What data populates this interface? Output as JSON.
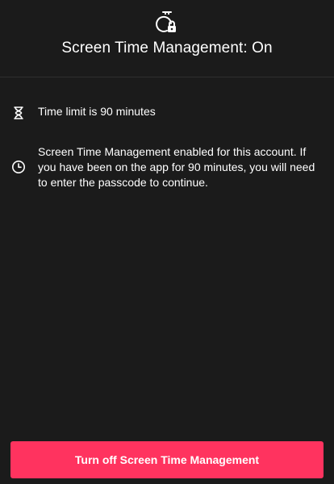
{
  "header": {
    "title": "Screen Time Management: On",
    "icon": "stopwatch-lock-icon"
  },
  "info": {
    "limit": {
      "icon": "hourglass-icon",
      "text": "Time limit is 90 minutes"
    },
    "description": {
      "icon": "clock-icon",
      "text": "Screen Time Management enabled for this account. If you have been on the app for 90 minutes, you will need to enter the passcode to continue."
    }
  },
  "actions": {
    "turn_off_label": "Turn off Screen Time Management",
    "accent_color": "#ff335f"
  },
  "theme": {
    "background": "#1b1b1b",
    "text": "#ffffff"
  }
}
